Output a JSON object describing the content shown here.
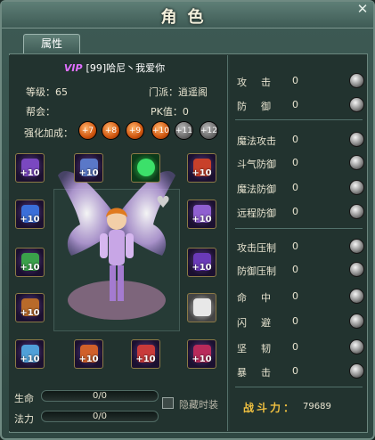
{
  "window": {
    "title": "角色",
    "close_glyph": "✕",
    "tab_label": "属性"
  },
  "player": {
    "vip_tag": "VIP",
    "name": "[99]哈尼丶我爱你"
  },
  "info": {
    "level_label": "等级：",
    "level_value": "65",
    "sect_label": "门派：",
    "sect_value": "逍遥阁",
    "guild_label": "帮会：",
    "guild_value": "",
    "pk_label": "PK值：",
    "pk_value": "0",
    "enhance_label": "强化加成："
  },
  "enhance_levels": [
    {
      "label": "+7",
      "active": true
    },
    {
      "label": "+8",
      "active": true
    },
    {
      "label": "+9",
      "active": true
    },
    {
      "label": "+10",
      "active": true
    },
    {
      "label": "+11",
      "active": false
    },
    {
      "label": "+12",
      "active": false
    }
  ],
  "equipment_slots": {
    "left": [
      "+10",
      "+10",
      "+10",
      "+10",
      "+10"
    ],
    "right": [
      "+10",
      "+10",
      "+10",
      "",
      "+10"
    ],
    "top": [
      "+10",
      ""
    ],
    "bottom": [
      "+10",
      "+10"
    ]
  },
  "bars": {
    "hp_label": "生命",
    "hp_value": "0/0",
    "mp_label": "法力",
    "mp_value": "0/0",
    "hide_fashion_label": "隐藏时装"
  },
  "stats": {
    "group1": [
      {
        "name": "攻击",
        "value": "0",
        "icon": "attack-icon"
      },
      {
        "name": "防御",
        "value": "0",
        "icon": "defense-icon"
      }
    ],
    "group2": [
      {
        "name": "魔法攻击",
        "value": "0",
        "icon": "magic-attack-icon"
      },
      {
        "name": "斗气防御",
        "value": "0",
        "icon": "qi-defense-icon"
      },
      {
        "name": "魔法防御",
        "value": "0",
        "icon": "magic-defense-icon"
      },
      {
        "name": "远程防御",
        "value": "0",
        "icon": "ranged-defense-icon"
      }
    ],
    "group3": [
      {
        "name": "攻击压制",
        "value": "0",
        "icon": "attack-suppress-icon"
      },
      {
        "name": "防御压制",
        "value": "0",
        "icon": "defense-suppress-icon"
      },
      {
        "name": "命中",
        "value": "0",
        "icon": "hit-icon"
      },
      {
        "name": "闪避",
        "value": "0",
        "icon": "dodge-icon"
      },
      {
        "name": "坚韧",
        "value": "0",
        "icon": "toughness-icon"
      },
      {
        "name": "暴击",
        "value": "0",
        "icon": "crit-icon"
      }
    ]
  },
  "combat_power": {
    "label": "战斗力：",
    "value": "79689"
  }
}
